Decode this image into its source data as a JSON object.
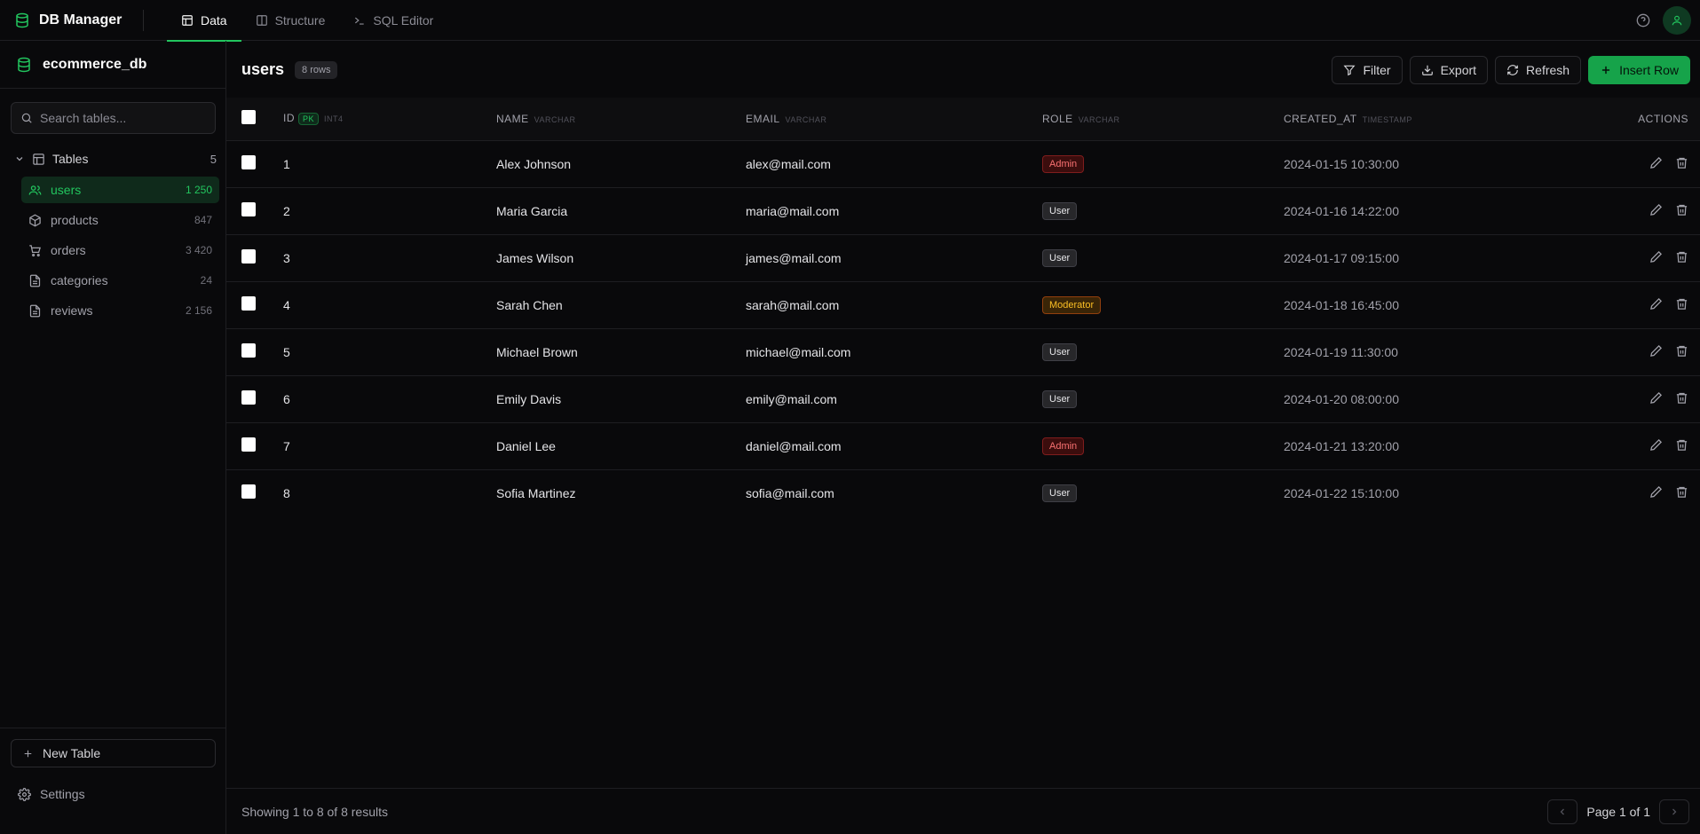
{
  "app": {
    "title": "DB Manager"
  },
  "nav": {
    "tabs": [
      {
        "label": "Data",
        "icon": "table-icon",
        "active": true
      },
      {
        "label": "Structure",
        "icon": "columns-icon",
        "active": false
      },
      {
        "label": "SQL Editor",
        "icon": "terminal-icon",
        "active": false
      }
    ]
  },
  "sidebar": {
    "database": "ecommerce_db",
    "search_placeholder": "Search tables...",
    "tables_label": "Tables",
    "tables_count": "5",
    "items": [
      {
        "label": "users",
        "count": "1 250",
        "icon": "users-icon",
        "active": true
      },
      {
        "label": "products",
        "count": "847",
        "icon": "package-icon",
        "active": false
      },
      {
        "label": "orders",
        "count": "3 420",
        "icon": "cart-icon",
        "active": false
      },
      {
        "label": "categories",
        "count": "24",
        "icon": "file-icon",
        "active": false
      },
      {
        "label": "reviews",
        "count": "2 156",
        "icon": "file-icon",
        "active": false
      }
    ],
    "new_table_label": "New Table",
    "settings_label": "Settings"
  },
  "main": {
    "table_name": "users",
    "row_badge": "8 rows",
    "buttons": {
      "filter": "Filter",
      "export": "Export",
      "refresh": "Refresh",
      "insert": "Insert Row"
    },
    "columns": [
      {
        "name": "ID",
        "type": "INT4",
        "pk": "PK"
      },
      {
        "name": "NAME",
        "type": "VARCHAR"
      },
      {
        "name": "EMAIL",
        "type": "VARCHAR"
      },
      {
        "name": "ROLE",
        "type": "VARCHAR"
      },
      {
        "name": "CREATED_AT",
        "type": "TIMESTAMP"
      },
      {
        "name": "ACTIONS"
      }
    ],
    "rows": [
      {
        "id": "1",
        "name": "Alex Johnson",
        "email": "alex@mail.com",
        "role": "Admin",
        "created_at": "2024-01-15 10:30:00"
      },
      {
        "id": "2",
        "name": "Maria Garcia",
        "email": "maria@mail.com",
        "role": "User",
        "created_at": "2024-01-16 14:22:00"
      },
      {
        "id": "3",
        "name": "James Wilson",
        "email": "james@mail.com",
        "role": "User",
        "created_at": "2024-01-17 09:15:00"
      },
      {
        "id": "4",
        "name": "Sarah Chen",
        "email": "sarah@mail.com",
        "role": "Moderator",
        "created_at": "2024-01-18 16:45:00"
      },
      {
        "id": "5",
        "name": "Michael Brown",
        "email": "michael@mail.com",
        "role": "User",
        "created_at": "2024-01-19 11:30:00"
      },
      {
        "id": "6",
        "name": "Emily Davis",
        "email": "emily@mail.com",
        "role": "User",
        "created_at": "2024-01-20 08:00:00"
      },
      {
        "id": "7",
        "name": "Daniel Lee",
        "email": "daniel@mail.com",
        "role": "Admin",
        "created_at": "2024-01-21 13:20:00"
      },
      {
        "id": "8",
        "name": "Sofia Martinez",
        "email": "sofia@mail.com",
        "role": "User",
        "created_at": "2024-01-22 15:10:00"
      }
    ],
    "footer": {
      "info": "Showing 1 to 8 of 8 results",
      "page_label": "Page 1 of 1"
    }
  },
  "colors": {
    "accent": "#22c55e",
    "background": "#09090b",
    "admin": "#f87171",
    "moderator": "#fbbf24"
  }
}
